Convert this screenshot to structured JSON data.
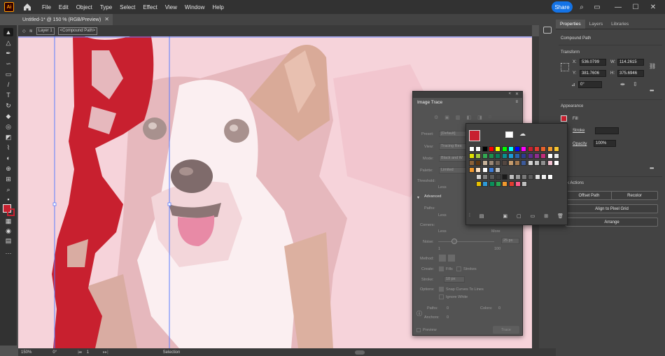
{
  "app": {
    "logo": "Ai"
  },
  "menu": [
    "File",
    "Edit",
    "Object",
    "Type",
    "Select",
    "Effect",
    "View",
    "Window",
    "Help"
  ],
  "share_label": "Share",
  "document": {
    "tab_title": "Untitled-1* @ 150 % (RGB/Preview)",
    "layer": "Layer 1",
    "path_crumb": "<Compound Path>"
  },
  "properties": {
    "tabs": [
      "Properties",
      "Layers",
      "Libraries"
    ],
    "selection": "Compound Path",
    "transform_label": "Transform",
    "x_label": "X:",
    "x": "536.0799",
    "y_label": "Y:",
    "y": "381.7606",
    "w_label": "W:",
    "w": "114.2615",
    "h_label": "H:",
    "h": "375.6946",
    "angle": "0°",
    "appearance_label": "Appearance",
    "fill_label": "Fill",
    "stroke_label": "Stroke",
    "opacity_label": "Opacity",
    "opacity": "100%",
    "quick_actions_label": "k Actions",
    "offset_path": "Offset Path",
    "recolor": "Recolor",
    "align_pixel": "Align to Pixel Grid",
    "arrange": "Arrange"
  },
  "image_trace": {
    "title": "Image Trace",
    "preset_label": "Preset:",
    "preset": "[Default]",
    "view_label": "View:",
    "view": "Tracing Res",
    "mode_label": "Mode:",
    "mode": "Black and W",
    "palette_label": "Palette:",
    "palette": "Limited",
    "threshold_label": "Threshold:",
    "less": "Less",
    "more": "More",
    "advanced_label": "Advanced",
    "paths_label": "Paths:",
    "corners_label": "Corners:",
    "noise_label": "Noise:",
    "noise_value": "25 px",
    "noise_min": "1",
    "noise_max": "100",
    "method_label": "Method:",
    "create_label": "Create:",
    "fills": "Fills",
    "strokes": "Strokes",
    "stroke_label": "Stroke:",
    "stroke_value": "10 px",
    "options_label": "Options:",
    "snap_curves": "Snap Curves To Lines",
    "ignore_white": "Ignore White",
    "paths_stat_label": "Paths:",
    "paths_stat": "0",
    "colors_stat_label": "Colors:",
    "colors_stat": "0",
    "anchors_stat_label": "Anchors:",
    "anchors_stat": "0",
    "preview_label": "Preview",
    "trace_label": "Trace"
  },
  "status": {
    "zoom": "150%",
    "rotation": "0°",
    "artboard": "1",
    "tool": "Selection"
  },
  "colors": {
    "accent": "#1473e6",
    "fill": "#c8202f",
    "canvas": "#f6d3da"
  }
}
